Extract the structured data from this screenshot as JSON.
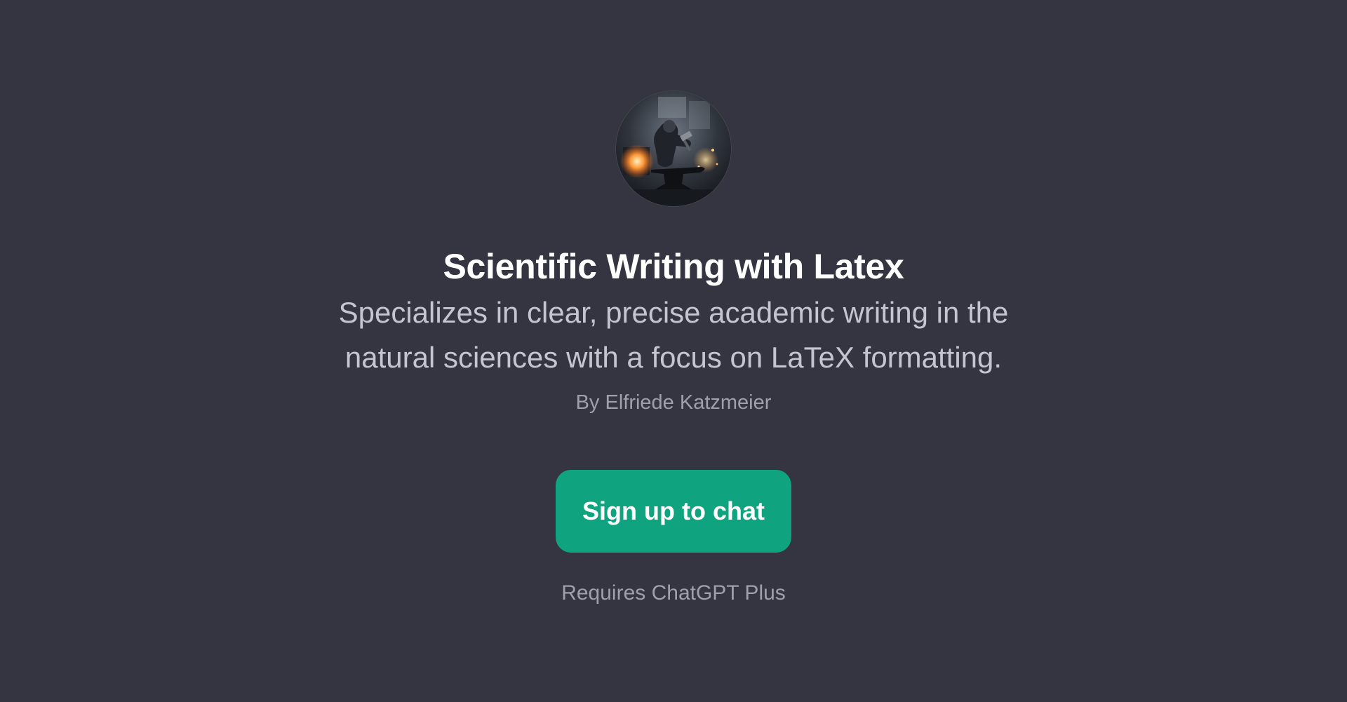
{
  "gpt": {
    "title": "Scientific Writing with Latex",
    "description": "Specializes in clear, precise academic writing in the natural sciences with a focus on LaTeX formatting.",
    "author": "By Elfriede Katzmeier",
    "avatar_icon": "blacksmith-at-anvil-avatar"
  },
  "cta": {
    "label": "Sign up to chat",
    "requirement": "Requires ChatGPT Plus"
  },
  "colors": {
    "background": "#343541",
    "accent": "#10a37f",
    "title": "#ffffff",
    "description": "#c5c5d2",
    "muted": "#a0a0aa"
  }
}
